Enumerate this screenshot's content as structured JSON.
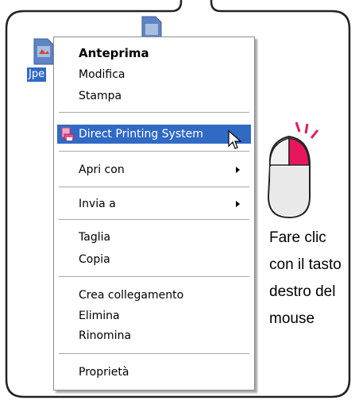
{
  "desktop": {
    "file_label": "Jpe"
  },
  "context_menu": {
    "items": [
      {
        "label": "Anteprima",
        "bold": true
      },
      {
        "label": "Modifica"
      },
      {
        "label": "Stampa"
      },
      {
        "label": "Direct Printing System",
        "highlighted": true
      },
      {
        "label": "Apri con",
        "submenu": true
      },
      {
        "label": "Invia a",
        "submenu": true
      },
      {
        "label": "Taglia"
      },
      {
        "label": "Copia"
      },
      {
        "label": "Crea collegamento"
      },
      {
        "label": "Elimina"
      },
      {
        "label": "Rinomina"
      },
      {
        "label": "Proprietà"
      }
    ]
  },
  "instruction": {
    "line1": "Fare clic",
    "line2": "con il tasto",
    "line3": "destro del",
    "line4": "mouse"
  },
  "colors": {
    "highlight": "#316ac5",
    "mouse_button": "#e8175d",
    "frame": "#222222"
  }
}
